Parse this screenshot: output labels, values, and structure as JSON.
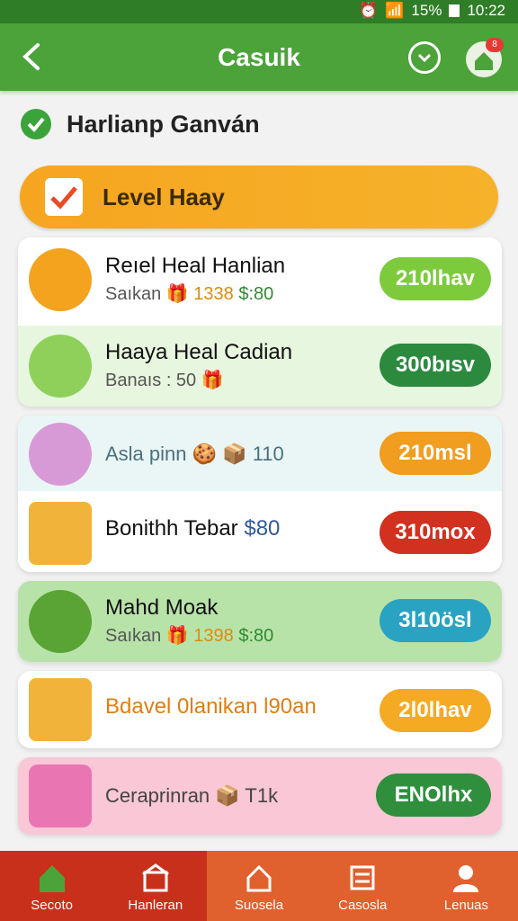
{
  "status_bar": {
    "battery": "15%",
    "time": "10:22"
  },
  "header": {
    "title": "Casuik",
    "badge": "8"
  },
  "section": {
    "title": "Harlianp Ganván"
  },
  "level": {
    "label": "Level Haay"
  },
  "rows": [
    {
      "title": "Reıel Heal Hanlian",
      "sub_a": "Saıkan",
      "sub_b": "1338",
      "sub_c": "$:80",
      "pill": "210lhav"
    },
    {
      "title": "Haaya Heal Cadian",
      "sub_a": "Banaıs : 50",
      "sub_b": "",
      "sub_c": "",
      "pill": "300bısv"
    },
    {
      "title": "Asla pinn",
      "sub_a": "110",
      "pill": "210msl"
    },
    {
      "title": "Bonithh Tebar",
      "sub_a": "$80",
      "pill": "310mox"
    },
    {
      "title": "Mahd Moak",
      "sub_a": "Saıkan",
      "sub_b": "1398",
      "sub_c": "$:80",
      "pill": "3l10ösl"
    },
    {
      "title": "Bdavel 0lanikan l90an",
      "pill": "2l0lhav"
    },
    {
      "title": "Ceraprinran",
      "sub_a": "T1k",
      "pill": "ENOlhx"
    }
  ],
  "nav": [
    "Secoto",
    "Hanleran",
    "Suosela",
    "Casosla",
    "Lenuas"
  ],
  "colors": {
    "green": "#4ca33a",
    "orange": "#f6a521",
    "red": "#c9301c"
  }
}
